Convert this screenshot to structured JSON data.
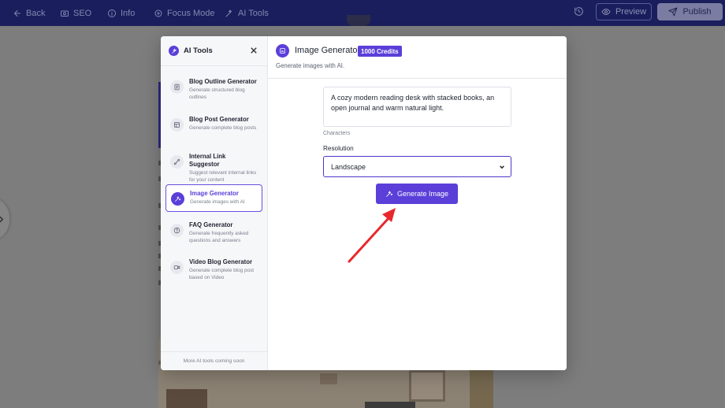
{
  "topbar": {
    "back_label": "Back",
    "seo_label": "SEO",
    "info_label": "Info",
    "focus_label": "Focus Mode",
    "ai_tools_label": "AI Tools",
    "preview_label": "Preview",
    "publish_label": "Publish"
  },
  "sidebar": {
    "title": "AI Tools",
    "footer": "More AI tools coming soon",
    "items": [
      {
        "name": "Blog Outline Generator",
        "desc": "Generate structured blog outlines",
        "icon": "outline-icon"
      },
      {
        "name": "Blog Post Generator",
        "desc": "Generate complete blog posts",
        "icon": "post-icon"
      },
      {
        "name": "Internal Link Suggestor",
        "desc": "Suggest relevant internal links for your content",
        "icon": "link-icon"
      },
      {
        "name": "Image Generator",
        "desc": "Generate images with AI",
        "icon": "image-icon"
      },
      {
        "name": "FAQ Generator",
        "desc": "Generate frequently asked questions and answers",
        "icon": "faq-icon"
      },
      {
        "name": "Video Blog Generator",
        "desc": "Generate complete blog post based on Video",
        "icon": "video-icon"
      }
    ],
    "active_index": 3
  },
  "main": {
    "title": "Image Generator",
    "credits": "1000 Credits",
    "subtitle": "Generate images with AI.",
    "prompt_value": "A cozy modern reading desk with stacked books, an open journal and warm natural light.",
    "chars_label": "Characters",
    "resolution_label": "Resolution",
    "resolution_value": "Landscape",
    "generate_label": "Generate Image"
  },
  "colors": {
    "accent": "#5b3fd9",
    "annotation_arrow": "#e8282b"
  }
}
